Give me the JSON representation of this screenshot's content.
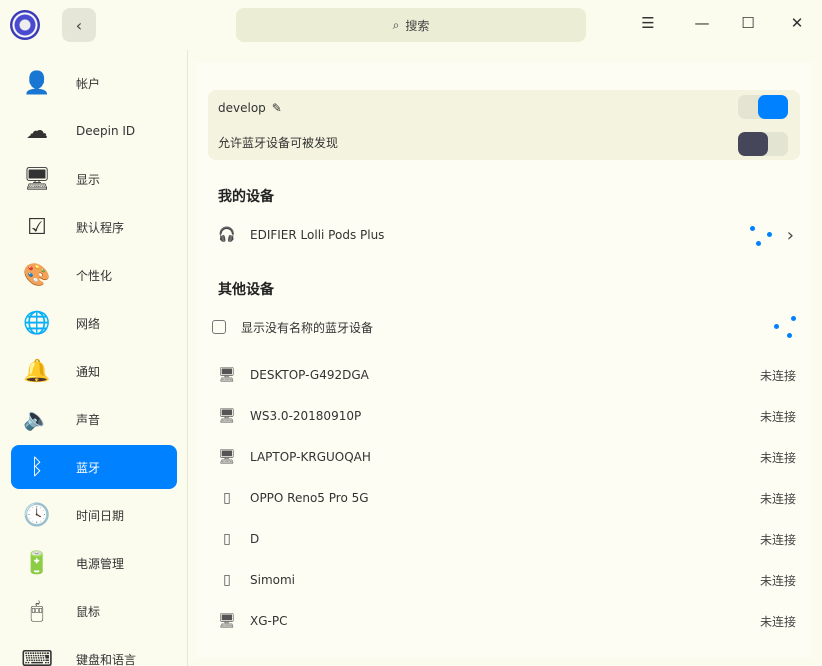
{
  "titlebar": {
    "search_placeholder": "搜索",
    "back": "‹",
    "menu": "☰",
    "minimize": "—",
    "maximize": "☐",
    "close": "✕"
  },
  "sidebar": {
    "items": [
      {
        "label": "帐户",
        "icon": "user-icon",
        "glyph": "👤"
      },
      {
        "label": "Deepin ID",
        "icon": "cloud-icon",
        "glyph": "☁"
      },
      {
        "label": "显示",
        "icon": "monitor-icon",
        "glyph": "🖥"
      },
      {
        "label": "默认程序",
        "icon": "default-apps-icon",
        "glyph": "☑"
      },
      {
        "label": "个性化",
        "icon": "palette-icon",
        "glyph": "🎨"
      },
      {
        "label": "网络",
        "icon": "network-icon",
        "glyph": "🌐"
      },
      {
        "label": "通知",
        "icon": "bell-icon",
        "glyph": "🔔"
      },
      {
        "label": "声音",
        "icon": "speaker-icon",
        "glyph": "🔈"
      },
      {
        "label": "蓝牙",
        "icon": "bluetooth-icon",
        "glyph": "ᛒ"
      },
      {
        "label": "时间日期",
        "icon": "clock-icon",
        "glyph": "🕓"
      },
      {
        "label": "电源管理",
        "icon": "battery-icon",
        "glyph": "🔋"
      },
      {
        "label": "鼠标",
        "icon": "mouse-icon",
        "glyph": "🖱"
      },
      {
        "label": "键盘和语言",
        "icon": "keyboard-icon",
        "glyph": "⌨"
      }
    ],
    "active": 8
  },
  "bluetooth": {
    "device_name": "develop",
    "power_on": true,
    "discoverable_label": "允许蓝牙设备可被发现",
    "discoverable": false,
    "accent": "#0081ff"
  },
  "my_devices": {
    "title": "我的设备",
    "items": [
      {
        "name": "EDIFIER Lolli Pods Plus",
        "icon": "headphones-icon"
      }
    ]
  },
  "other_devices": {
    "title": "其他设备",
    "show_unnamed_label": "显示没有名称的蓝牙设备",
    "show_unnamed": false,
    "items": [
      {
        "name": "DESKTOP-G492DGA",
        "icon": "computer-icon",
        "status": "未连接"
      },
      {
        "name": "WS3.0-20180910P",
        "icon": "computer-icon",
        "status": "未连接"
      },
      {
        "name": "LAPTOP-KRGUOQAH",
        "icon": "computer-icon",
        "status": "未连接"
      },
      {
        "name": "OPPO Reno5 Pro 5G",
        "icon": "phone-icon",
        "status": "未连接"
      },
      {
        "name": "D",
        "icon": "phone-icon",
        "status": "未连接"
      },
      {
        "name": "Simomi",
        "icon": "phone-icon",
        "status": "未连接"
      },
      {
        "name": "XG-PC",
        "icon": "computer-icon",
        "status": "未连接"
      }
    ]
  }
}
